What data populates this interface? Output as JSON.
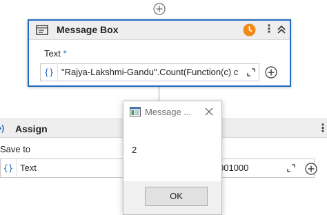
{
  "message_box": {
    "title": "Message Box",
    "text_label": "Text",
    "required_marker": "*",
    "braces": "{}",
    "expression": "\"Rajya-Lakshmi-Gandu\".Count(Function(c) c"
  },
  "assign": {
    "title": "Assign",
    "save_to_label": "Save to",
    "braces": "{}",
    "field_value": "Text",
    "value_tail": "001000"
  },
  "dialog": {
    "title": "Message ...",
    "message": "2",
    "ok_label": "OK"
  },
  "icons": {
    "top_add": "plus-circle-icon",
    "header_icon": "message-box-icon",
    "clock": "clock-icon",
    "menu": "kebab-menu-icon",
    "collapse": "collapse-icon",
    "expand": "expand-icon",
    "close": "close-icon"
  },
  "colors": {
    "accent": "#1f6bc2",
    "warning_clock": "#f28b1a",
    "header_bg": "#eeeeee",
    "dialog_footer": "#f0f0f0"
  }
}
